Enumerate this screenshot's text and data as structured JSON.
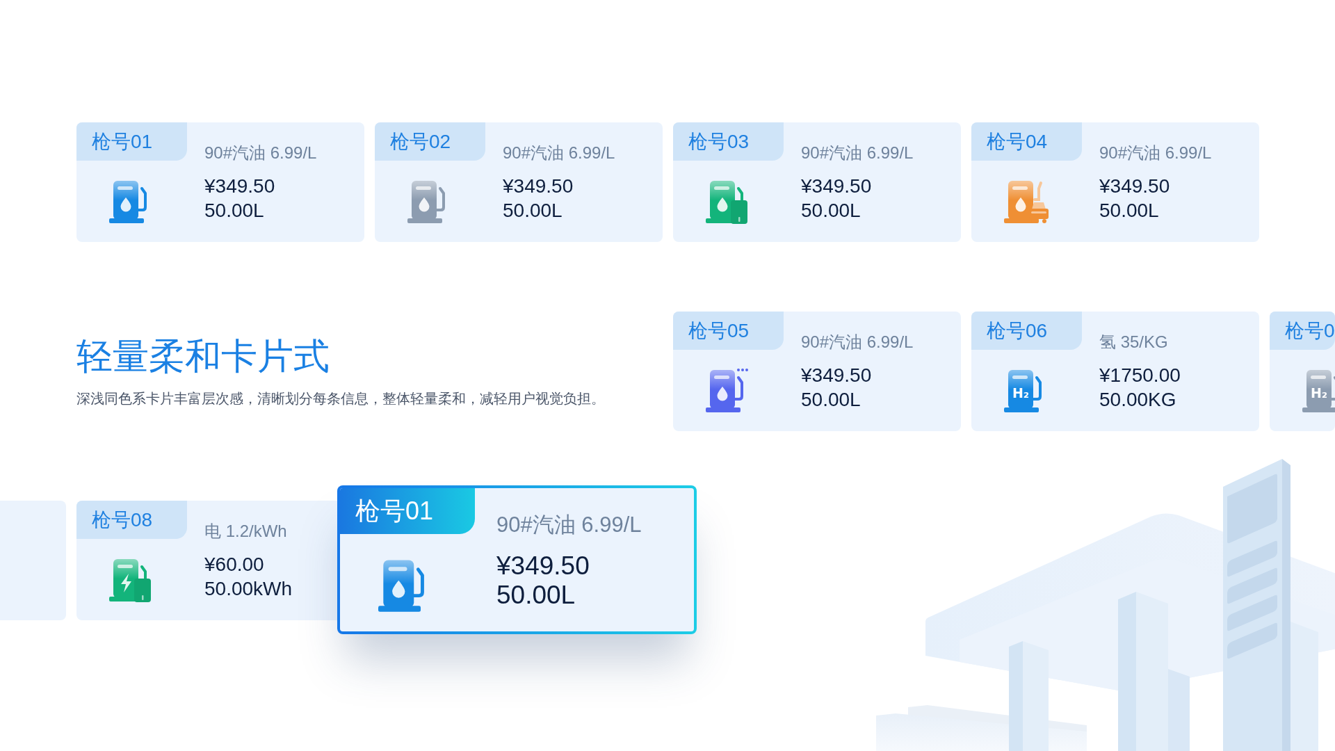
{
  "cards_top": [
    {
      "gun": "枪号01",
      "rate": "90#汽油 6.99/L",
      "amount": "¥349.50",
      "volume": "50.00L",
      "icon": {
        "kind": "fuel",
        "color": "#1689e3"
      }
    },
    {
      "gun": "枪号02",
      "rate": "90#汽油 6.99/L",
      "amount": "¥349.50",
      "volume": "50.00L",
      "icon": {
        "kind": "fuel",
        "color": "#8c9cb0"
      }
    },
    {
      "gun": "枪号03",
      "rate": "90#汽油 6.99/L",
      "amount": "¥349.50",
      "volume": "50.00L",
      "icon": {
        "kind": "fuel_battery",
        "color": "#13b47b"
      }
    },
    {
      "gun": "枪号04",
      "rate": "90#汽油 6.99/L",
      "amount": "¥349.50",
      "volume": "50.00L",
      "icon": {
        "kind": "fuel_car",
        "color": "#ef8f34"
      }
    }
  ],
  "intro": {
    "title": "轻量柔和卡片式",
    "description": "深浅同色系卡片丰富层次感，清晰划分每条信息，整体轻量柔和，减轻用户视觉负担。"
  },
  "cards_middle": [
    {
      "gun": "枪号05",
      "rate": "90#汽油 6.99/L",
      "amount": "¥349.50",
      "volume": "50.00L",
      "icon": {
        "kind": "fuel_dots",
        "color": "#5566ee"
      }
    },
    {
      "gun": "枪号06",
      "rate": "氢 35/KG",
      "amount": "¥1750.00",
      "volume": "50.00KG",
      "icon": {
        "kind": "hydrogen",
        "color": "#1689e3",
        "label": "H₂"
      }
    },
    {
      "gun": "枪号0",
      "icon": {
        "kind": "hydrogen",
        "color": "#8c9cb0",
        "label": "H₂"
      }
    }
  ],
  "cards_bottom": [
    {
      "gun": "枪号08",
      "rate": "电 1.2/kWh",
      "amount": "¥60.00",
      "volume": "50.00kWh",
      "icon": {
        "kind": "charger",
        "color": "#13b47b"
      }
    }
  ],
  "featured_card": {
    "gun": "枪号01",
    "rate": "90#汽油 6.99/L",
    "amount": "¥349.50",
    "volume": "50.00L",
    "icon": {
      "kind": "fuel",
      "color": "#1689e3"
    }
  }
}
